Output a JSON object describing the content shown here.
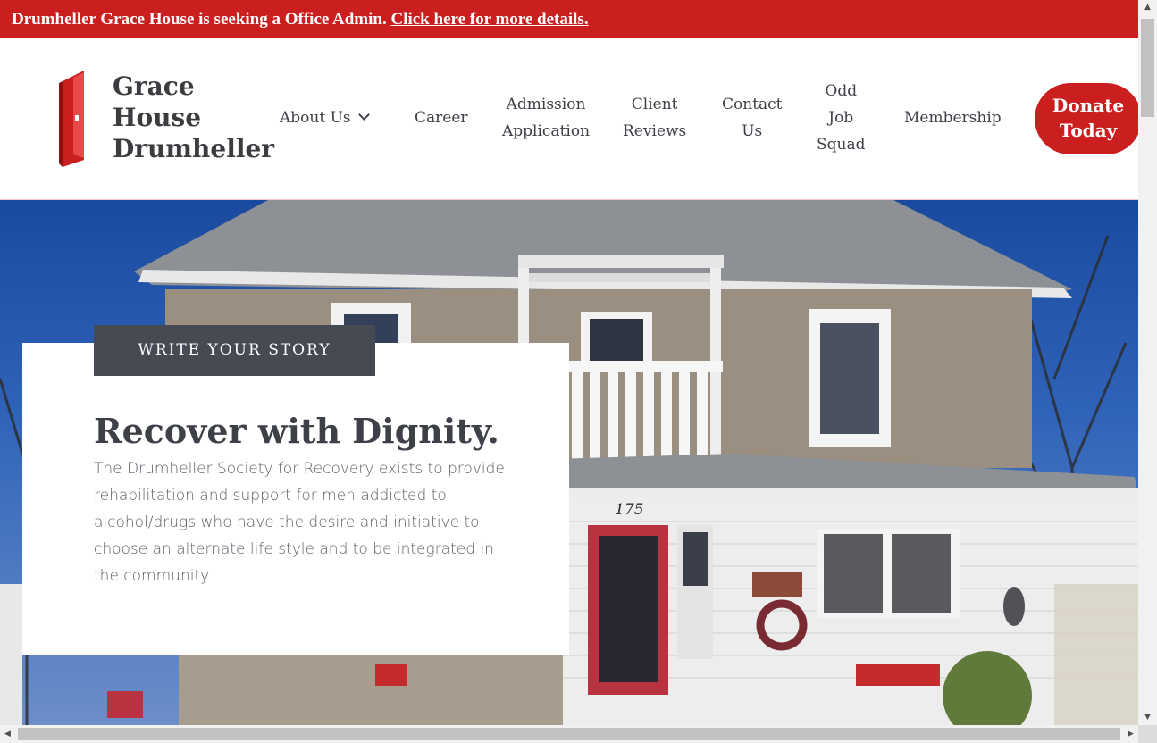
{
  "announcement": {
    "text": "Drumheller Grace House is seeking a Office Admin.",
    "link": "Click here for more details."
  },
  "logo": {
    "line1": "Grace",
    "line2": "House",
    "line3": "Drumheller"
  },
  "nav": {
    "about": "About Us",
    "career": "Career",
    "admission_1": "Admission",
    "admission_2": "Application",
    "reviews_1": "Client",
    "reviews_2": "Reviews",
    "contact_1": "Contact",
    "contact_2": "Us",
    "odd_1": "Odd",
    "odd_2": "Job",
    "odd_3": "Squad",
    "membership": "Membership",
    "donate_1": "Donate",
    "donate_2": "Today"
  },
  "hero": {
    "tag": "WRITE YOUR STORY",
    "headline": "Recover with Dignity.",
    "description": "The Drumheller Society for Recovery exists to provide rehabilitation and support for men addicted to alcohol/drugs who have the desire and initiative to choose an alternate life style and to be integrated in the community.",
    "house_number": "175"
  },
  "colors": {
    "brand_red": "#cb1f1f",
    "dark_gray": "#464a53",
    "text_dark": "#3d4047"
  },
  "icons": {
    "logo": "red-door-icon",
    "dropdown": "chevron-down-icon"
  }
}
